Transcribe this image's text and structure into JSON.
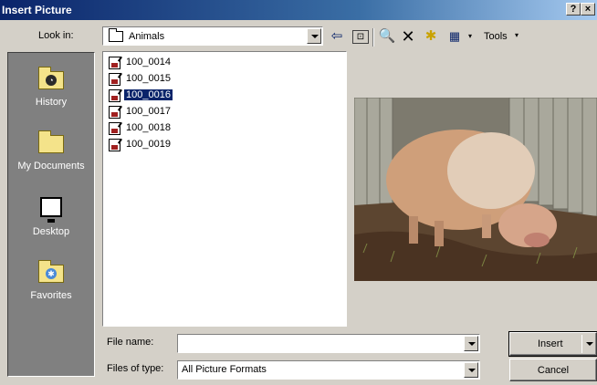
{
  "window": {
    "title": "Insert Picture",
    "help_glyph": "?",
    "close_glyph": "×"
  },
  "lookin": {
    "label": "Look in:",
    "value": "Animals"
  },
  "toolbar": {
    "back_glyph": "⇦",
    "up_glyph": "⊡",
    "search_glyph": "🔍",
    "delete_glyph": "✕",
    "newfolder_glyph": "✱",
    "views_glyph": "▦",
    "dropdown_glyph": "▾",
    "tools_label": "Tools"
  },
  "places": [
    {
      "label": "History",
      "icon": "history-icon"
    },
    {
      "label": "My Documents",
      "icon": "my-documents-icon"
    },
    {
      "label": "Desktop",
      "icon": "desktop-icon"
    },
    {
      "label": "Favorites",
      "icon": "favorites-icon"
    }
  ],
  "files": [
    {
      "name": "100_0014",
      "selected": false
    },
    {
      "name": "100_0015",
      "selected": false
    },
    {
      "name": "100_0016",
      "selected": true
    },
    {
      "name": "100_0017",
      "selected": false
    },
    {
      "name": "100_0018",
      "selected": false
    },
    {
      "name": "100_0019",
      "selected": false
    }
  ],
  "filename": {
    "label": "File name:",
    "value": ""
  },
  "filetype": {
    "label": "Files of type:",
    "value": "All Picture Formats"
  },
  "buttons": {
    "insert": "Insert",
    "cancel": "Cancel"
  },
  "colors": {
    "title_bar": "#0a246a",
    "selection": "#0a246a",
    "places_bar": "#808080",
    "face": "#d4d0c8"
  }
}
